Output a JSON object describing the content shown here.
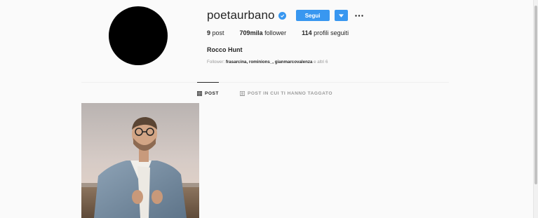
{
  "profile": {
    "username": "poetaurbano",
    "follow_label": "Segui",
    "full_name": "Rocco Hunt",
    "stats": {
      "posts_count": "9",
      "posts_label": "post",
      "followers_count": "709mila",
      "followers_label": "follower",
      "following_count": "114",
      "following_label": "profili seguiti"
    },
    "followed_by": {
      "prefix": "Follower:",
      "accounts": [
        "frasarcina",
        "rominions_",
        "gianmarcovalenza"
      ],
      "suffix": "e altri 6"
    }
  },
  "tabs": {
    "post": "POST",
    "tagged": "POST IN CUI TI HANNO TAGGATO"
  },
  "icons": {
    "verified": "verified-badge-icon",
    "dropdown": "chevron-down-icon",
    "more": "more-options-icon",
    "grid": "grid-icon",
    "tagged": "tagged-icon"
  },
  "colors": {
    "accent": "#3897f0",
    "background": "#fafafa",
    "text": "#262626",
    "muted": "#999999"
  }
}
